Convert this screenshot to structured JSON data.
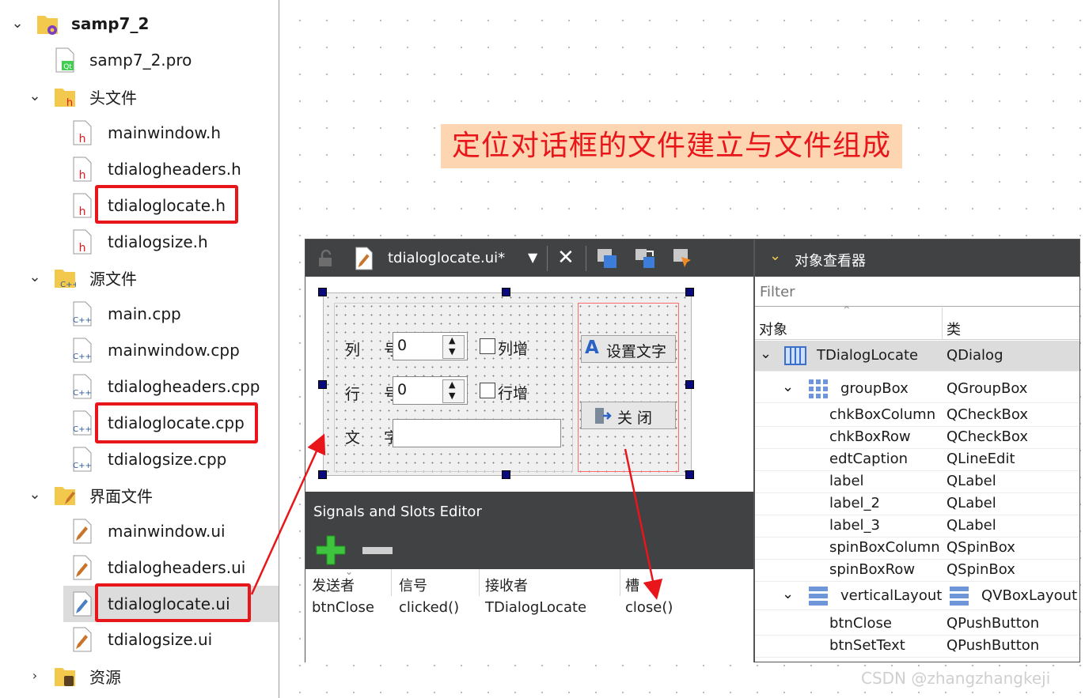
{
  "project_tree": {
    "root": "samp7_2",
    "pro_file": "samp7_2.pro",
    "groups": [
      {
        "label": "头文件",
        "items": [
          "mainwindow.h",
          "tdialogheaders.h",
          "tdialoglocate.h",
          "tdialogsize.h"
        ]
      },
      {
        "label": "源文件",
        "items": [
          "main.cpp",
          "mainwindow.cpp",
          "tdialogheaders.cpp",
          "tdialoglocate.cpp",
          "tdialogsize.cpp"
        ]
      },
      {
        "label": "界面文件",
        "items": [
          "mainwindow.ui",
          "tdialogheaders.ui",
          "tdialoglocate.ui",
          "tdialogsize.ui"
        ]
      },
      {
        "label": "资源",
        "items": []
      }
    ],
    "icon_labels": {
      "header": "h",
      "source": "C++",
      "pro": "Qt"
    }
  },
  "banner": {
    "text": "定位对话框的文件建立与文件组成"
  },
  "designer": {
    "file_tab": "tdialoglocate.ui*",
    "form": {
      "col_label": "列 号",
      "col_value": "0",
      "col_check": "列增",
      "row_label": "行 号",
      "row_value": "0",
      "row_check": "行增",
      "text_label": "文 字",
      "text_value": "",
      "btn_set_text": "设置文字",
      "btn_close": "关 闭"
    },
    "signals_editor": {
      "title": "Signals and Slots Editor",
      "columns": [
        "发送者",
        "信号",
        "接收者",
        "槽"
      ],
      "rows": [
        {
          "sender": "btnClose",
          "signal": "clicked()",
          "receiver": "TDialogLocate",
          "slot": "close()"
        }
      ]
    }
  },
  "inspector": {
    "title": "对象查看器",
    "filter_placeholder": "Filter",
    "columns": [
      "对象",
      "类"
    ],
    "rows": [
      {
        "object": "TDialogLocate",
        "class": "QDialog"
      },
      {
        "object": "groupBox",
        "class": "QGroupBox"
      },
      {
        "object": "chkBoxColumn",
        "class": "QCheckBox"
      },
      {
        "object": "chkBoxRow",
        "class": "QCheckBox"
      },
      {
        "object": "edtCaption",
        "class": "QLineEdit"
      },
      {
        "object": "label",
        "class": "QLabel"
      },
      {
        "object": "label_2",
        "class": "QLabel"
      },
      {
        "object": "label_3",
        "class": "QLabel"
      },
      {
        "object": "spinBoxColumn",
        "class": "QSpinBox"
      },
      {
        "object": "spinBoxRow",
        "class": "QSpinBox"
      },
      {
        "object": "verticalLayout",
        "class": "QVBoxLayout"
      },
      {
        "object": "btnClose",
        "class": "QPushButton"
      },
      {
        "object": "btnSetText",
        "class": "QPushButton"
      }
    ]
  },
  "watermark": "CSDN @zhangzhangkeji",
  "colors": {
    "highlight_red": "#e8161b",
    "banner_bg": "#fdd5b1",
    "toolbar_dark": "#404244",
    "selection_gray": "#dcdcdc"
  }
}
